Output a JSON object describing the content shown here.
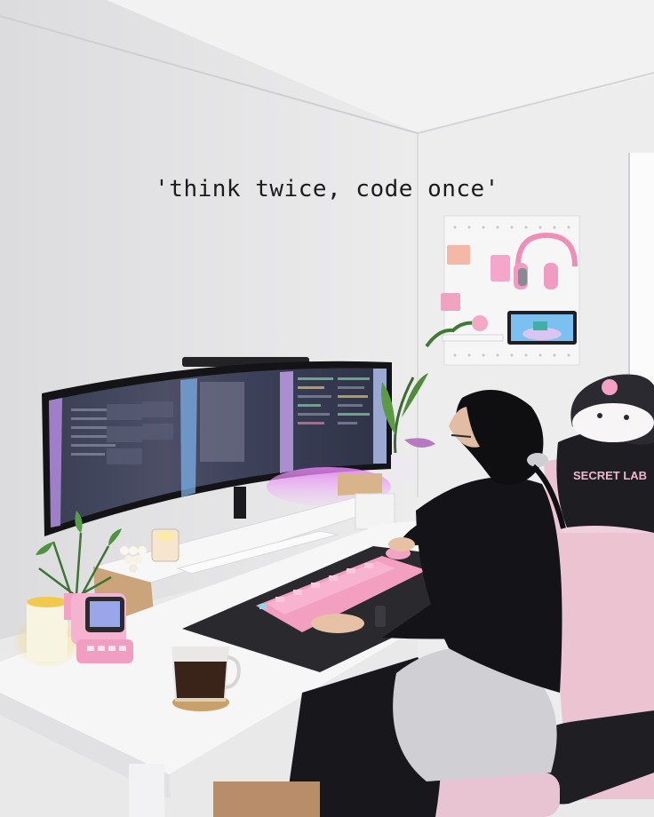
{
  "caption": "'think twice, code once'",
  "chair_brand": "SECRET LAB",
  "colors": {
    "wall": "#e7e7e8",
    "ceiling": "#f1f1f2",
    "desk": "#f5f5f5",
    "accent_pink": "#f4a5c7",
    "monitor_glow": "#d96ce8"
  }
}
